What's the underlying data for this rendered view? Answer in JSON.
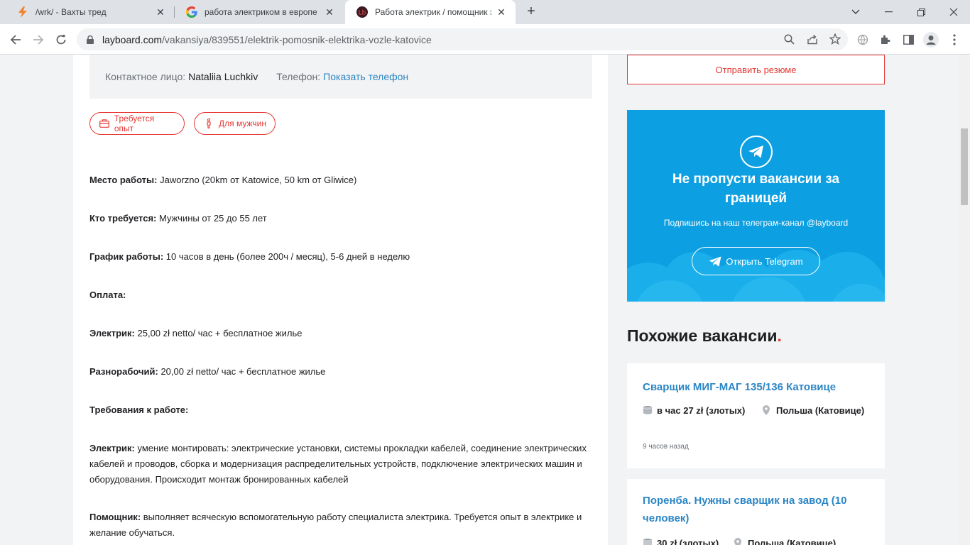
{
  "browser": {
    "tabs": [
      {
        "title": "/wrk/ - Вахты тред",
        "icon": "bolt-icon"
      },
      {
        "title": "работа электриком в европе - П",
        "icon": "google-icon"
      },
      {
        "title": "Работа электрик / помощник эл",
        "icon": "layboard-icon"
      }
    ],
    "new_tab_label": "+",
    "url_host": "layboard.com",
    "url_path": "/vakansiya/839551/elektrik-pomosnik-elektrika-vozle-katovice"
  },
  "contact": {
    "person_label": "Контактное лицо:",
    "person_name": "Nataliia Luchkiv",
    "phone_label": "Телефон:",
    "phone_link": "Показать телефон"
  },
  "tags": [
    "Требуется опыт",
    "Для мужчин"
  ],
  "description": [
    {
      "label": "Место работы:",
      "text": " Jaworzno (20km от Katowice, 50 km от Gliwice)"
    },
    {
      "label": "Кто требуется:",
      "text": " Мужчины от 25 до 55 лет"
    },
    {
      "label": "График работы:",
      "text": " 10 часов в день (более 200ч / месяц), 5-6 дней в неделю"
    },
    {
      "label": "Оплата:",
      "text": ""
    },
    {
      "label": "Электрик:",
      "text": " 25,00 zł netto/ час + бесплатное жилье"
    },
    {
      "label": "Разнорабочий:",
      "text": " 20,00 zł netto/ час + бесплатное жилье"
    },
    {
      "label": "Требования к работе:",
      "text": ""
    },
    {
      "label": "Электрик:",
      "text": " умение монтировать: электрические установки, системы прокладки кабелей, соединение электрических кабелей и проводов, сборка и модернизация распределительных устройств, подключение электрических машин и оборудования. Происходит монтаж бронированных кабелей"
    },
    {
      "label": "Помощник:",
      "text": " выполняет всяческую вспомогательную работу специалиста электрика. Требуется опыт в электрике и желание обучаться."
    }
  ],
  "sidebar": {
    "send_resume": "Отправить резюме",
    "telegram": {
      "title": "Не пропусти вакансии за границей",
      "subtitle": "Подпишись на наш телеграм-канал @layboard",
      "button": "Открыть Telegram"
    },
    "similar_heading": "Похожие вакансии",
    "similar_dot": ".",
    "jobs": [
      {
        "title": "Сварщик МИГ-МАГ 135/136 Катовице",
        "pay": "в час 27 zł (злотых)",
        "location": "Польша (Катовице)",
        "time": "9 часов назад"
      },
      {
        "title": "Поренба. Нужны сварщик на завод (10 человек)",
        "pay": "30 zł (злотых)",
        "location": "Польша (Катовице)",
        "time": ""
      }
    ]
  }
}
